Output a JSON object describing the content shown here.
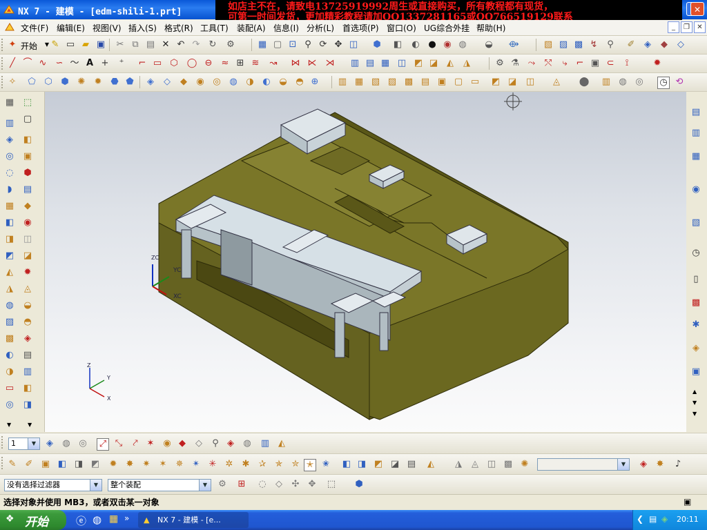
{
  "titlebar": {
    "title": "NX 7 - 建模 - [edm-shili-1.prt]",
    "ad_line1": "如店主不在，请致电13725919992周生或直接购买，所有教程都有现货，",
    "ad_line2": "可第一时间发货，更加精彩教程请加QQ1337281165或QQ766519129联系",
    "min": "_",
    "restore": "❐",
    "close": "✕"
  },
  "menubar": {
    "items": [
      "文件(F)",
      "编辑(E)",
      "视图(V)",
      "插入(S)",
      "格式(R)",
      "工具(T)",
      "装配(A)",
      "信息(I)",
      "分析(L)",
      "首选项(P)",
      "窗口(O)",
      "UG综合外挂",
      "帮助(H)"
    ]
  },
  "toolbar1": {
    "start_label": "开始"
  },
  "toolbar4": {
    "layer_value": "1"
  },
  "viewport": {
    "wcs_x": "XC",
    "wcs_y": "YC",
    "wcs_z": "ZC",
    "abs_x": "X",
    "abs_y": "Y",
    "abs_z": "Z"
  },
  "selectionbar": {
    "filter_value": "没有选择过滤器",
    "scope_value": "整个装配"
  },
  "status": {
    "prompt": "选择对象并使用 MB3，或者双击某一对象"
  },
  "taskbar": {
    "start": "开始",
    "app": "NX 7 - 建模 - [e...",
    "clock": "20:11"
  },
  "colors": {
    "part_olive": "#6d6a22",
    "part_top": "#7a7628",
    "insert_light": "#d6e0e6",
    "ad_red": "#ff1a1a"
  }
}
